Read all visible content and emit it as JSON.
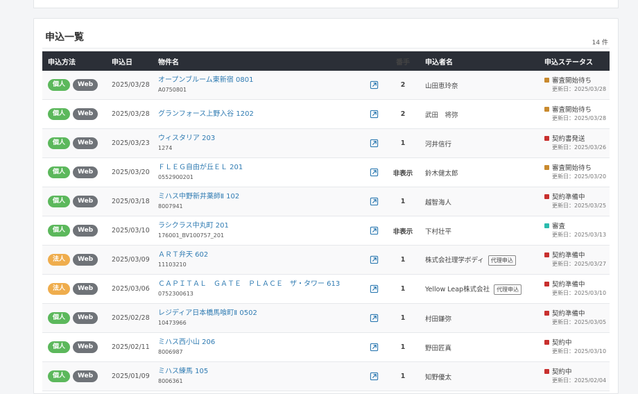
{
  "section": {
    "title": "申込一覧",
    "count": "14 件"
  },
  "columns": {
    "method": "申込方法",
    "date": "申込日",
    "property": "物件名",
    "ban": "番手",
    "applicant": "申込者名",
    "status": "申込ステータス"
  },
  "labels": {
    "updated_prefix": "更新日："
  },
  "colors": {
    "header_bg": "#2b2f37",
    "kojin": "#5cb85c",
    "hojin": "#efad4d",
    "web": "#6f7378",
    "link": "#2f7bb2",
    "status_review_wait": "#c98a2e",
    "status_red": "#c8302e",
    "status_review": "#2bbbad"
  },
  "rows": [
    {
      "type": "個人",
      "type_kind": "kojin",
      "channel": "Web",
      "date": "2025/03/28",
      "property": "オープンブルーム東新宿 0801",
      "code": "A0750801",
      "ban": "2",
      "applicant": "山田恵玲奈",
      "proxy": "",
      "status": "審査開始待ち",
      "status_color": "#c98a2e",
      "updated": "更新日：2025/03/28"
    },
    {
      "type": "個人",
      "type_kind": "kojin",
      "channel": "Web",
      "date": "2025/03/28",
      "property": "グランフォース上野入谷 1202",
      "code": "",
      "ban": "2",
      "applicant": "武田　将弥",
      "proxy": "",
      "status": "審査開始待ち",
      "status_color": "#c98a2e",
      "updated": "更新日：2025/03/28"
    },
    {
      "type": "個人",
      "type_kind": "kojin",
      "channel": "Web",
      "date": "2025/03/23",
      "property": "ウィスタリア 203",
      "code": "1274",
      "ban": "1",
      "applicant": "河井信行",
      "proxy": "",
      "status": "契約書発送",
      "status_color": "#c8302e",
      "updated": "更新日：2025/03/26"
    },
    {
      "type": "個人",
      "type_kind": "kojin",
      "channel": "Web",
      "date": "2025/03/20",
      "property": "ＦＬＥＧ自由が丘ＥＬ 201",
      "code": "0552900201",
      "ban": "非表示",
      "applicant": "鈴木健太郎",
      "proxy": "",
      "status": "審査開始待ち",
      "status_color": "#c98a2e",
      "updated": "更新日：2025/03/20"
    },
    {
      "type": "個人",
      "type_kind": "kojin",
      "channel": "Web",
      "date": "2025/03/18",
      "property": "ミハス中野新井薬師Ⅱ 102",
      "code": "8007941",
      "ban": "1",
      "applicant": "越智海人",
      "proxy": "",
      "status": "契約準備中",
      "status_color": "#c8302e",
      "updated": "更新日：2025/03/25"
    },
    {
      "type": "個人",
      "type_kind": "kojin",
      "channel": "Web",
      "date": "2025/03/10",
      "property": "ラシクラス中丸町 201",
      "code": "176001_BV100757_201",
      "ban": "非表示",
      "applicant": "下村壮平",
      "proxy": "",
      "status": "審査",
      "status_color": "#2bbbad",
      "updated": "更新日：2025/03/13"
    },
    {
      "type": "法人",
      "type_kind": "hojin",
      "channel": "Web",
      "date": "2025/03/09",
      "property": "ＡＲＴ弁天 602",
      "code": "11103210",
      "ban": "1",
      "applicant": "株式会社理学ボディ",
      "proxy": "代理申込",
      "status": "契約準備中",
      "status_color": "#c8302e",
      "updated": "更新日：2025/03/27"
    },
    {
      "type": "法人",
      "type_kind": "hojin",
      "channel": "Web",
      "date": "2025/03/06",
      "property": "ＣＡＰＩＴＡＬ　ＧＡＴＥ　ＰＬＡＣＥ　ザ・タワー 613",
      "code": "0752300613",
      "ban": "1",
      "applicant": "Yellow Leap株式会社",
      "proxy": "代理申込",
      "status": "契約準備中",
      "status_color": "#c8302e",
      "updated": "更新日：2025/03/10"
    },
    {
      "type": "個人",
      "type_kind": "kojin",
      "channel": "Web",
      "date": "2025/02/28",
      "property": "レジディア日本橋馬喰町Ⅱ 0502",
      "code": "10473966",
      "ban": "1",
      "applicant": "村田鎌弥",
      "proxy": "",
      "status": "契約準備中",
      "status_color": "#c8302e",
      "updated": "更新日：2025/03/05"
    },
    {
      "type": "個人",
      "type_kind": "kojin",
      "channel": "Web",
      "date": "2025/02/11",
      "property": "ミハス西小山 206",
      "code": "8006987",
      "ban": "1",
      "applicant": "野田匠真",
      "proxy": "",
      "status": "契約中",
      "status_color": "#c8302e",
      "updated": "更新日：2025/03/10"
    },
    {
      "type": "個人",
      "type_kind": "kojin",
      "channel": "Web",
      "date": "2025/01/09",
      "property": "ミハス練馬 105",
      "code": "8006361",
      "ban": "1",
      "applicant": "知野優太",
      "proxy": "",
      "status": "契約中",
      "status_color": "#c8302e",
      "updated": "更新日：2025/02/04"
    }
  ]
}
